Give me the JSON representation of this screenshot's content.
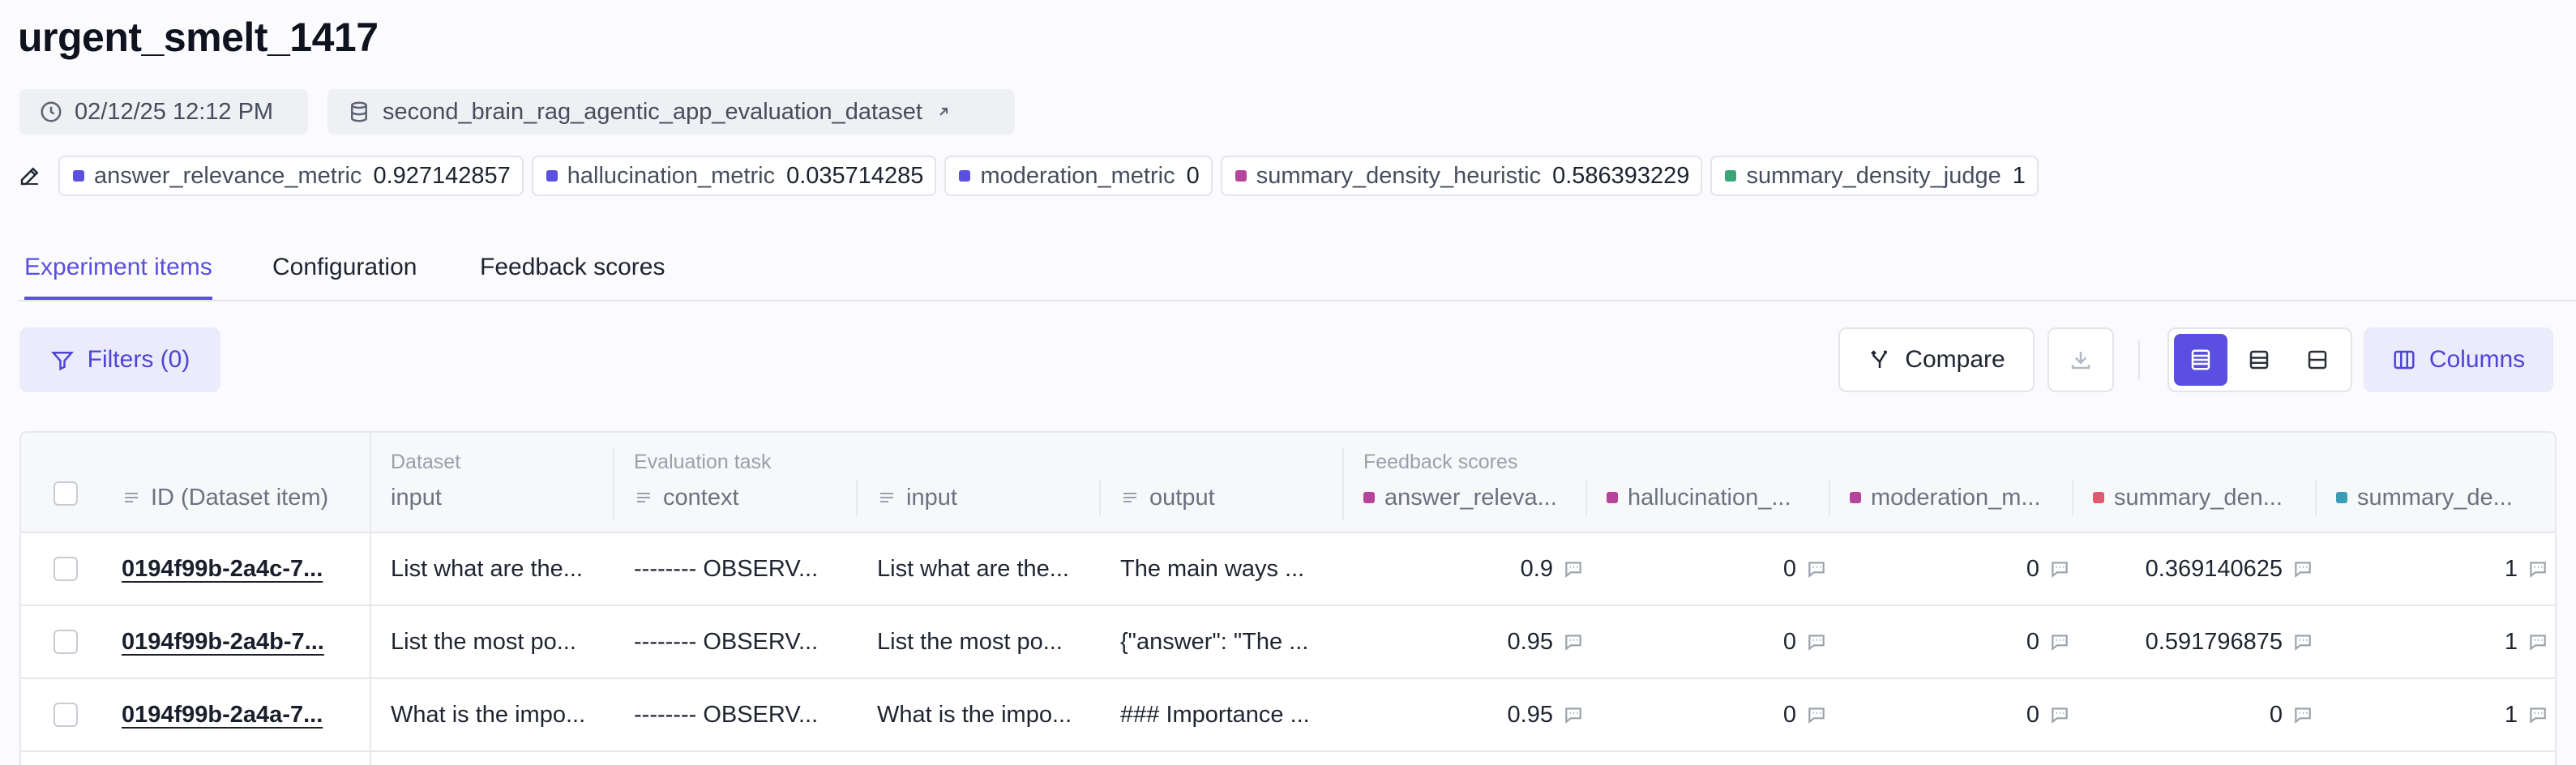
{
  "experiment": {
    "title": "urgent_smelt_1417",
    "created": "02/12/25 12:12 PM",
    "dataset": "second_brain_rag_agentic_app_evaluation_dataset"
  },
  "scores": [
    {
      "name": "answer_relevance_metric",
      "value": "0.927142857",
      "color": "#5a4fe0"
    },
    {
      "name": "hallucination_metric",
      "value": "0.035714285",
      "color": "#5a4fe0"
    },
    {
      "name": "moderation_metric",
      "value": "0",
      "color": "#5a4fe0"
    },
    {
      "name": "summary_density_heuristic",
      "value": "0.586393229",
      "color": "#b5449b"
    },
    {
      "name": "summary_density_judge",
      "value": "1",
      "color": "#3aa776"
    }
  ],
  "tabs": [
    {
      "label": "Experiment items",
      "active": true
    },
    {
      "label": "Configuration",
      "active": false
    },
    {
      "label": "Feedback scores",
      "active": false
    }
  ],
  "toolbar": {
    "filters_label": "Filters (0)",
    "compare_label": "Compare",
    "columns_label": "Columns"
  },
  "table": {
    "group_labels": {
      "dataset": "Dataset",
      "evaluation_task": "Evaluation task",
      "feedback_scores": "Feedback scores"
    },
    "columns": [
      {
        "label": "ID (Dataset item)"
      },
      {
        "label": "input"
      },
      {
        "label": "context"
      },
      {
        "label": "input"
      },
      {
        "label": "output"
      },
      {
        "label": "answer_releva...",
        "color": "#b5449b"
      },
      {
        "label": "hallucination_...",
        "color": "#b5449b"
      },
      {
        "label": "moderation_m...",
        "color": "#b5449b"
      },
      {
        "label": "summary_den...",
        "color": "#e05a6e"
      },
      {
        "label": "summary_de...",
        "color": "#3a9db3"
      }
    ],
    "rows": [
      {
        "id": "0194f99b-2a4c-7...",
        "dataset_input": "List what are the...",
        "context": "-------- OBSERV...",
        "input": "List what are the...",
        "output": "The main ways ...",
        "answer_relevance": "0.9",
        "hallucination": "0",
        "moderation": "0",
        "summary_density_heuristic": "0.369140625",
        "summary_density_judge": "1"
      },
      {
        "id": "0194f99b-2a4b-7...",
        "dataset_input": "List the most po...",
        "context": "-------- OBSERV...",
        "input": "List the most po...",
        "output": "{\"answer\": \"The ...",
        "answer_relevance": "0.95",
        "hallucination": "0",
        "moderation": "0",
        "summary_density_heuristic": "0.591796875",
        "summary_density_judge": "1"
      },
      {
        "id": "0194f99b-2a4a-7...",
        "dataset_input": "What is the impo...",
        "context": "-------- OBSERV...",
        "input": "What is the impo...",
        "output": "### Importance ...",
        "answer_relevance": "0.95",
        "hallucination": "0",
        "moderation": "0",
        "summary_density_heuristic": "0",
        "summary_density_judge": "1"
      }
    ]
  },
  "icons": {
    "clock": "clock-icon",
    "database": "database-icon",
    "external": "external-link-icon",
    "pencil": "pencil-icon",
    "filter": "filter-icon",
    "compare": "compare-icon",
    "download": "download-icon",
    "columns": "columns-icon",
    "feedback": "comment-icon"
  },
  "colors": {
    "accent": "#5a4fe0",
    "accent_soft": "#ebebfb"
  }
}
